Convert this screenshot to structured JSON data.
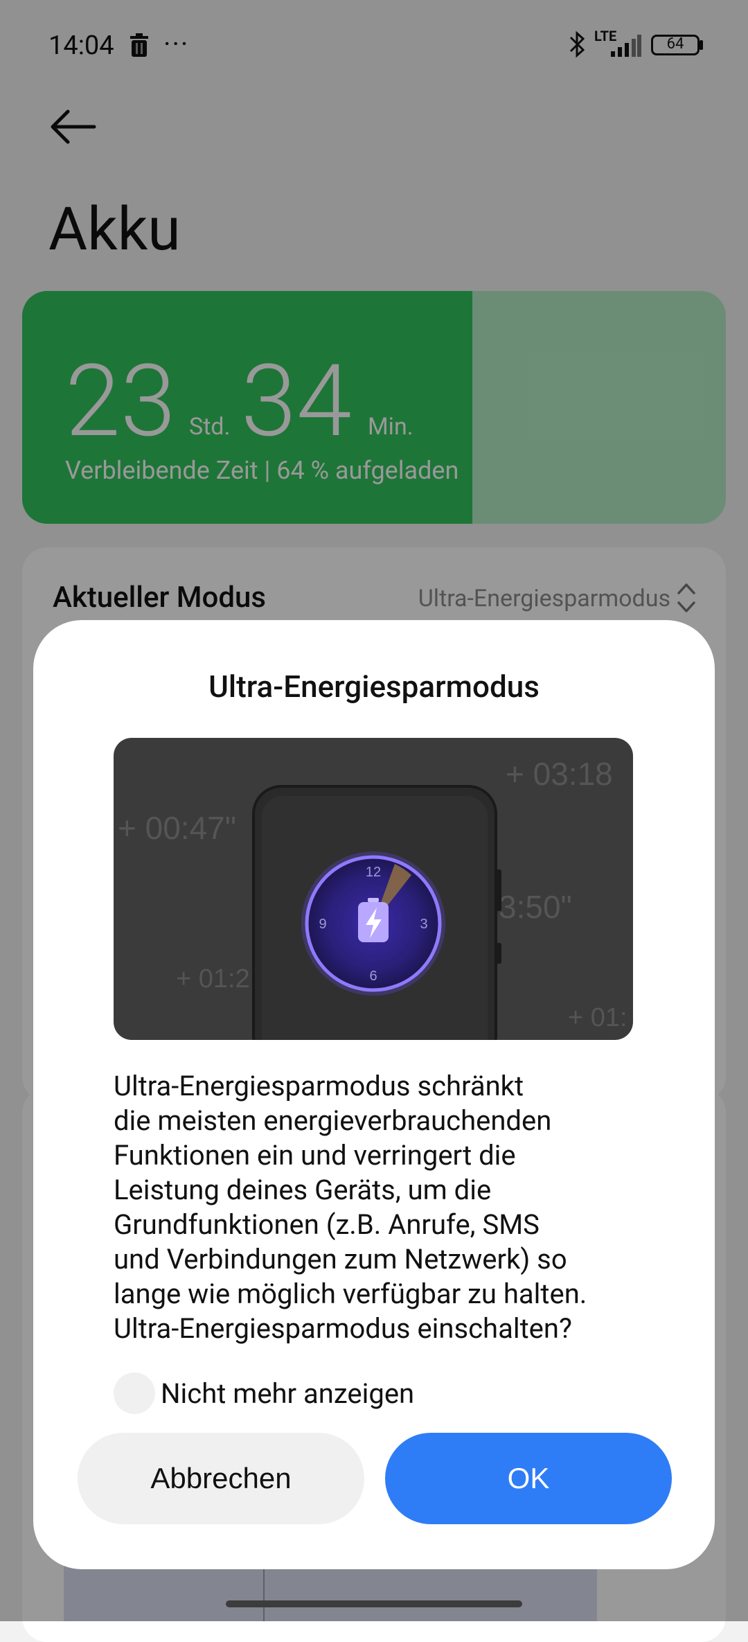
{
  "status_bar": {
    "time": "14:04",
    "dots": "···",
    "network": "LTE",
    "battery": "64"
  },
  "page": {
    "title": "Akku"
  },
  "battery_card": {
    "hours": "23",
    "hours_unit": "Std.",
    "minutes": "34",
    "minutes_unit": "Min.",
    "subtitle": "Verbleibende Zeit | 64 % aufgeladen",
    "charge_fraction": 0.64,
    "fill_color": "#32c45e",
    "track_color": "#b4ebc4"
  },
  "mode": {
    "label": "Aktueller Modus",
    "value": "Ultra-Energiesparmodus"
  },
  "dialog": {
    "title": "Ultra-Energiesparmodus",
    "illustration": {
      "times": [
        "+ 00:47\"",
        "+ 03:18",
        "3:50\"",
        "+ 01:2",
        "+ 01:"
      ],
      "clock_numbers": [
        "12",
        "3",
        "6",
        "9"
      ]
    },
    "body_lines": [
      "Ultra-Energiesparmodus schränkt",
      "die meisten energieverbrauchenden",
      "Funktionen ein und verringert die",
      "Leistung deines Geräts, um die",
      "Grundfunktionen (z.B. Anrufe, SMS",
      "und Verbindungen zum Netzwerk) so",
      "lange wie möglich verfügbar zu halten.",
      "Ultra-Energiesparmodus einschalten?"
    ],
    "checkbox_label": "Nicht mehr anzeigen",
    "cancel_label": "Abbrechen",
    "ok_label": "OK",
    "ok_color": "#2f7df6"
  }
}
